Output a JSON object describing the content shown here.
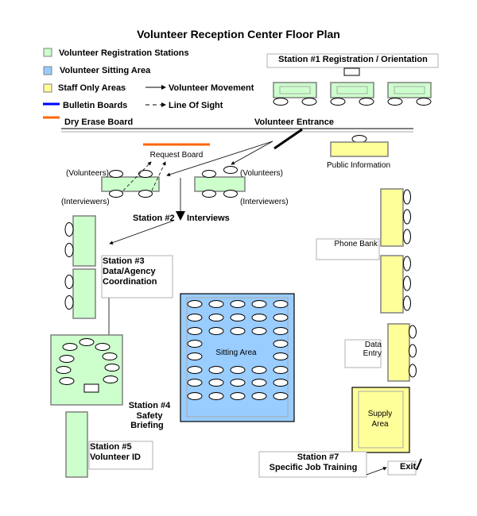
{
  "title": "Volunteer Reception Center Floor Plan",
  "colors": {
    "registration": "#ccffcc",
    "sitting": "#99ccff",
    "staff": "#ffff99",
    "bulletin": "#0000ff",
    "dry_erase": "#ff6600"
  },
  "legend": {
    "registration": "Volunteer Registration Stations",
    "sitting": "Volunteer Sitting Area",
    "staff": "Staff Only Areas",
    "bulletin": "Bulletin Boards",
    "dry_erase": "Dry Erase Board",
    "movement": "Volunteer Movement",
    "sight": "Line Of Sight"
  },
  "labels": {
    "station1": "Station #1  Registration / Orientation",
    "entrance": "Volunteer Entrance",
    "request_board": "Request Board",
    "volunteers": "(Volunteers)",
    "interviewers": "(Interviewers)",
    "station2": "Station #2",
    "interviews": "Interviews",
    "public_info": "Public Information",
    "phone_bank": "Phone Bank",
    "station3": [
      "Station #3",
      "Data/Agency",
      "Coordination"
    ],
    "sitting_area": "Sitting Area",
    "data_entry": [
      "Data",
      "Entry"
    ],
    "station4": [
      "Station #4",
      "Safety",
      "Briefing"
    ],
    "supply": [
      "Supply",
      "Area"
    ],
    "station5": [
      "Station #5",
      "Volunteer ID"
    ],
    "station7": [
      "Station #7",
      "Specific Job Training"
    ],
    "exit": "Exit"
  }
}
